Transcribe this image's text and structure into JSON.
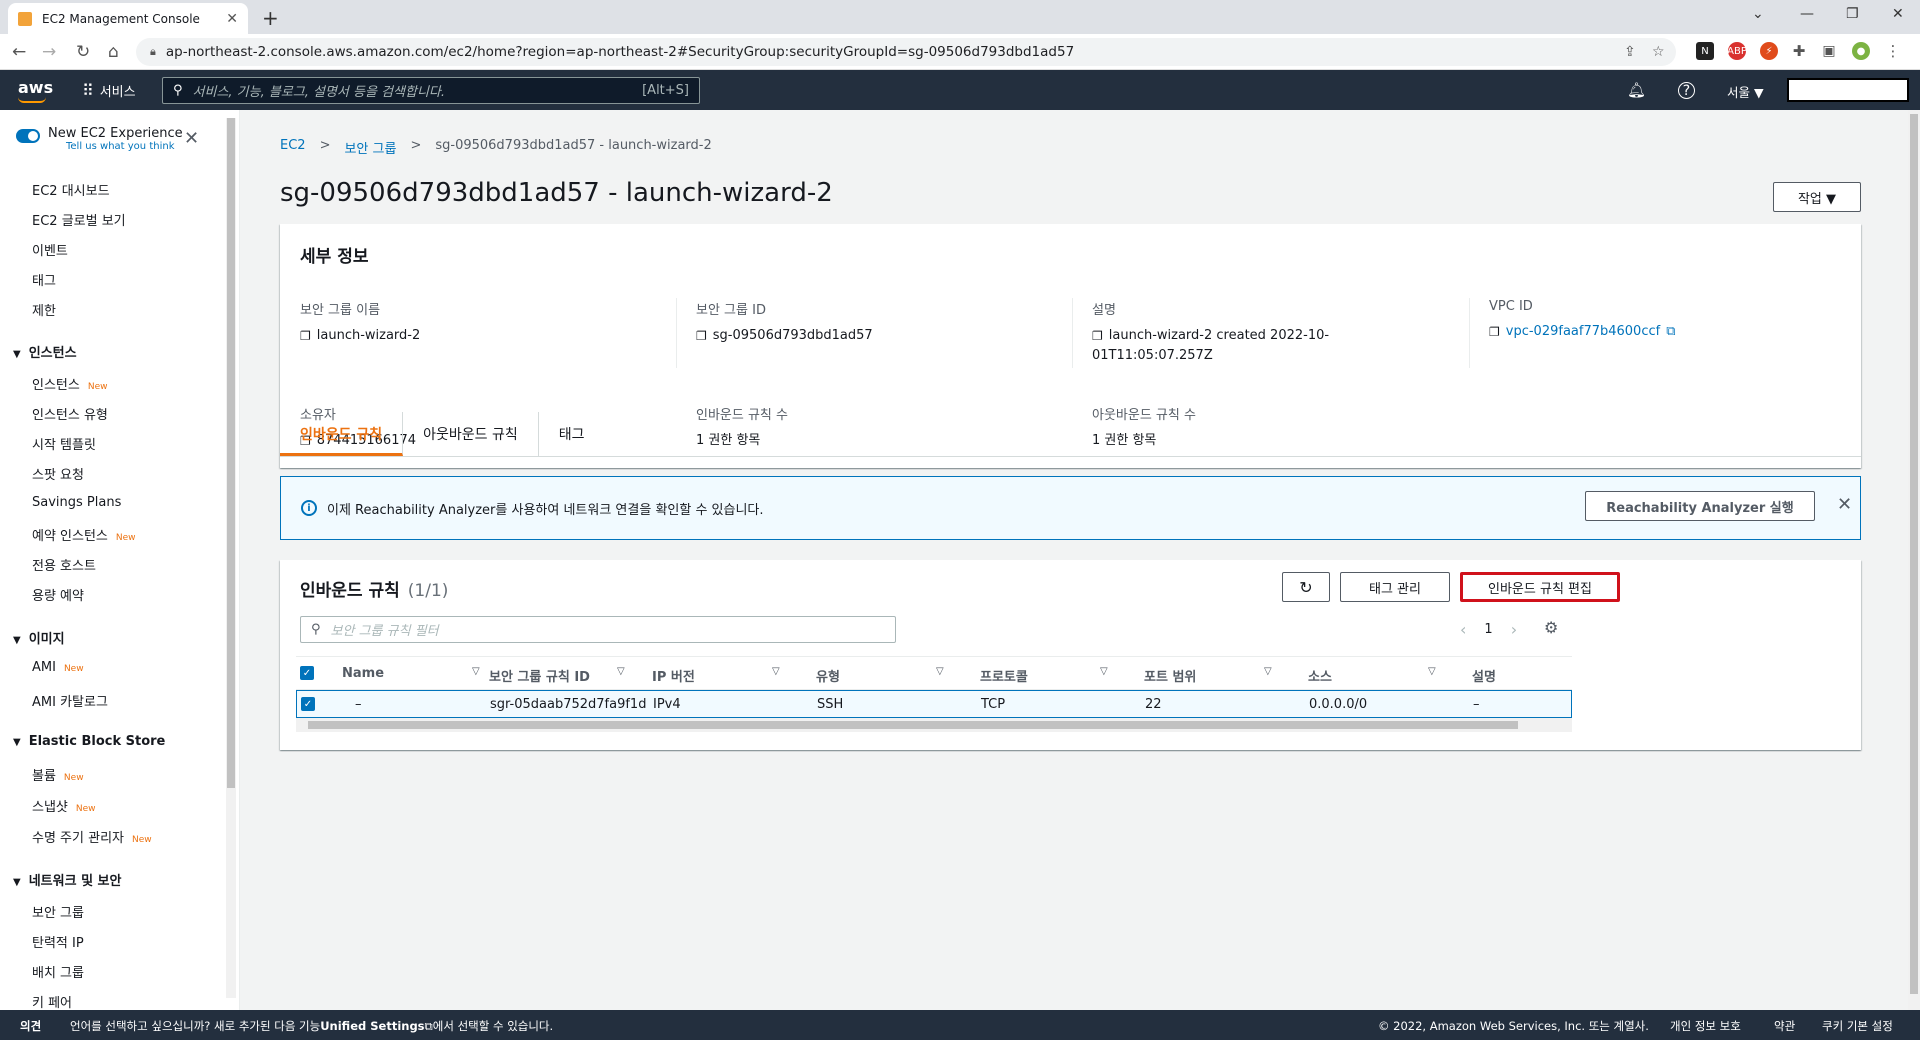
{
  "browser": {
    "tab_title": "EC2 Management Console",
    "url": "ap-northeast-2.console.aws.amazon.com/ec2/home?region=ap-northeast-2#SecurityGroup:securityGroupId=sg-09506d793dbd1ad57"
  },
  "aws_header": {
    "logo": "aws",
    "services_label": "서비스",
    "search_placeholder": "서비스, 기능, 블로그, 설명서 등을 검색합니다.",
    "search_shortcut": "[Alt+S]",
    "region": "서울 ▼"
  },
  "sidebar": {
    "new_experience_title": "New EC2 Experience",
    "new_experience_sub": "Tell us what you think",
    "top_items": [
      "EC2 대시보드",
      "EC2 글로벌 보기",
      "이벤트",
      "태그",
      "제한"
    ],
    "sections": [
      {
        "title": "인스턴스",
        "items": [
          {
            "label": "인스턴스",
            "badge": "New"
          },
          {
            "label": "인스턴스 유형",
            "badge": ""
          },
          {
            "label": "시작 템플릿",
            "badge": ""
          },
          {
            "label": "스팟 요청",
            "badge": ""
          },
          {
            "label": "Savings Plans",
            "badge": ""
          },
          {
            "label": "예약 인스턴스",
            "badge": "New"
          },
          {
            "label": "전용 호스트",
            "badge": ""
          },
          {
            "label": "용량 예약",
            "badge": ""
          }
        ]
      },
      {
        "title": "이미지",
        "items": [
          {
            "label": "AMI",
            "badge": "New"
          },
          {
            "label": "AMI 카탈로그",
            "badge": ""
          }
        ]
      },
      {
        "title": "Elastic Block Store",
        "items": [
          {
            "label": "볼륨",
            "badge": "New"
          },
          {
            "label": "스냅샷",
            "badge": "New"
          },
          {
            "label": "수명 주기 관리자",
            "badge": "New"
          }
        ]
      },
      {
        "title": "네트워크 및 보안",
        "items": [
          {
            "label": "보안 그룹",
            "badge": ""
          },
          {
            "label": "탄력적 IP",
            "badge": ""
          },
          {
            "label": "배치 그룹",
            "badge": ""
          },
          {
            "label": "키 페어",
            "badge": ""
          }
        ]
      }
    ]
  },
  "breadcrumb": {
    "c1": "EC2",
    "c2": "보안 그룹",
    "c3": "sg-09506d793dbd1ad57 - launch-wizard-2",
    "sep": ">"
  },
  "page_title": "sg-09506d793dbd1ad57 - launch-wizard-2",
  "actions_label": "작업 ▼",
  "details": {
    "header": "세부 정보",
    "sg_name_label": "보안 그룹 이름",
    "sg_name": "launch-wizard-2",
    "sg_id_label": "보안 그룹 ID",
    "sg_id": "sg-09506d793dbd1ad57",
    "desc_label": "설명",
    "desc_line1": "launch-wizard-2 created 2022-10-",
    "desc_line2": "01T11:05:07.257Z",
    "vpc_label": "VPC ID",
    "vpc_id": "vpc-029faaf77b4600ccf",
    "owner_label": "소유자",
    "owner": "874415166174",
    "inbound_count_label": "인바운드 규칙 수",
    "inbound_count": "1 권한 항목",
    "outbound_count_label": "아웃바운드 규칙 수",
    "outbound_count": "1 권한 항목"
  },
  "tabs": [
    "인바운드 규칙",
    "아웃바운드 규칙",
    "태그"
  ],
  "info_banner": {
    "text": "이제 Reachability Analyzer를 사용하여 네트워크 연결을 확인할 수 있습니다.",
    "button": "Reachability Analyzer 실행"
  },
  "rules": {
    "title": "인바운드 규칙",
    "count": "(1/1)",
    "manage_tags": "태그 관리",
    "edit_rules": "인바운드 규칙 편집",
    "filter_placeholder": "보안 그룹 규칙 필터",
    "page": "1",
    "columns": [
      "Name",
      "보안 그룹 규칙 ID",
      "IP 버전",
      "유형",
      "프로토콜",
      "포트 범위",
      "소스",
      "설명"
    ],
    "row": [
      "–",
      "sgr-05daab752d7fa9f1d",
      "IPv4",
      "SSH",
      "TCP",
      "22",
      "0.0.0.0/0",
      "–"
    ]
  },
  "footer": {
    "feedback": "의견",
    "lang_text": "언어를 선택하고 싶으십니까? 새로 추가된 다음 기능",
    "unified": "Unified Settings",
    "lang_text2": "에서 선택할 수 있습니다.",
    "copyright": "© 2022, Amazon Web Services, Inc. 또는 계열사.",
    "privacy": "개인 정보 보호",
    "terms": "약관",
    "cookies": "쿠키 기본 설정"
  }
}
